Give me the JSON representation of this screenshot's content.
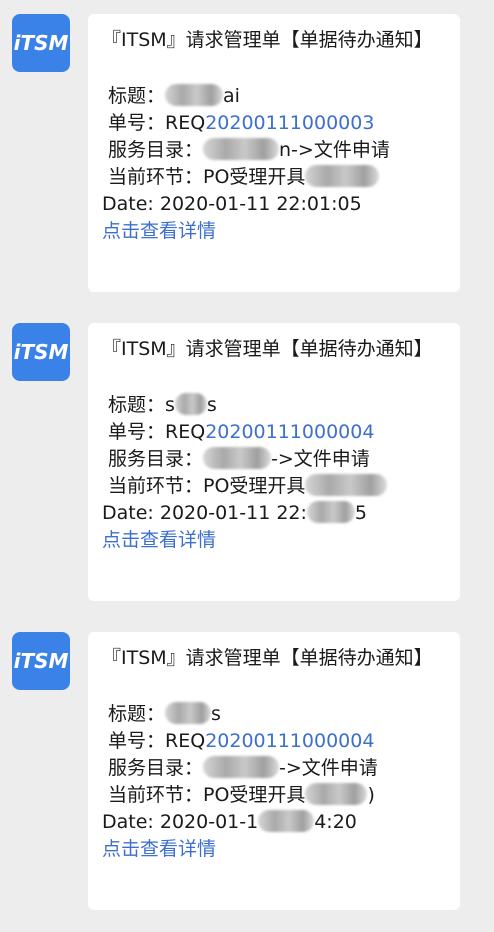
{
  "avatar_logo": "iTSM",
  "messages": [
    {
      "title": "『ITSM』请求管理单【单据待办通知】",
      "title_label": "标题：",
      "title_value": "ai",
      "number_label": "单号：",
      "number_prefix": "REQ",
      "number_value": "20200111000003",
      "catalog_label": "服务目录：",
      "catalog_value": "n->文件申请",
      "step_label": "当前环节：",
      "step_value": "PO受理开具",
      "date_label": "Date: ",
      "date_value": "2020-01-11 22:01:05",
      "detail_link": "点击查看详情"
    },
    {
      "title": "『ITSM』请求管理单【单据待办通知】",
      "title_label": "标题：",
      "title_value": "s",
      "title_value_tail": "s",
      "number_label": "单号：",
      "number_prefix": "REQ",
      "number_value": "20200111000004",
      "catalog_label": "服务目录：",
      "catalog_value": "->文件申请",
      "step_label": "当前环节：",
      "step_value": "PO受理开具",
      "date_label": "Date: ",
      "date_value": "2020-01-11 22:",
      "date_tail": "5",
      "detail_link": "点击查看详情"
    },
    {
      "title": "『ITSM』请求管理单【单据待办通知】",
      "title_label": "标题：",
      "title_value": "s",
      "number_label": "单号：",
      "number_prefix": "REQ",
      "number_value": "20200111000004",
      "catalog_label": "服务目录：",
      "catalog_value": "->文件申请",
      "step_label": "当前环节：",
      "step_value": "PO受理开具",
      "step_tail": ")",
      "date_label": "Date: ",
      "date_value": "2020-01-1",
      "date_tail": "4:20",
      "detail_link": "点击查看详情"
    }
  ]
}
